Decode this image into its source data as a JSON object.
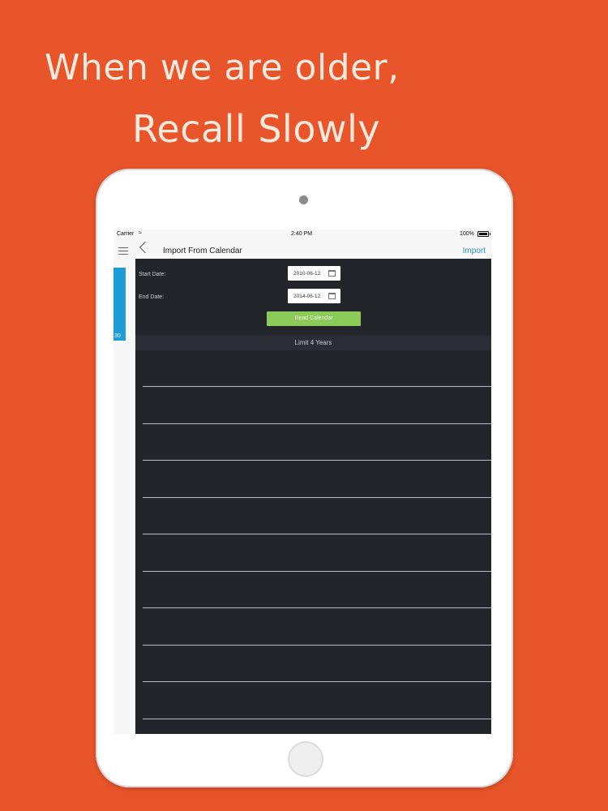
{
  "promo": {
    "line1": "When we are older,",
    "line2": "Recall Slowly"
  },
  "statusbar": {
    "carrier": "Carrier",
    "time": "2:40 PM",
    "battery": "100%"
  },
  "sidebar": {
    "count": "30"
  },
  "navbar": {
    "title": "Import From Calendar",
    "action": "Import"
  },
  "form": {
    "start_label": "Start Date:",
    "start_value": "2010-06-12",
    "end_label": "End Date:",
    "end_value": "2014-06-12",
    "read_button": "Read Calendar",
    "limit_text": "Limit 4 Years"
  },
  "colors": {
    "background": "#e8552a",
    "accent_blue": "#1e9cd8",
    "button_green": "#8ccb5a",
    "content_dark": "#22262b"
  }
}
